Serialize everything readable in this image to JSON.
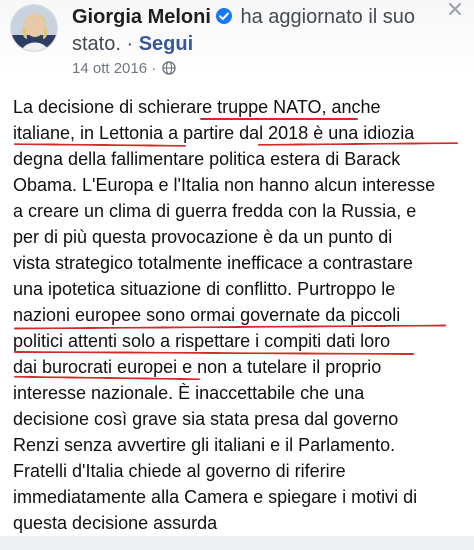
{
  "post": {
    "author": "Giorgia Meloni",
    "verified_icon": "verified-badge-icon",
    "action": "ha aggiornato il suo",
    "action_cont": "stato.",
    "separator": "·",
    "follow_label": "Segui",
    "date": "14 ott 2016",
    "date_separator": "·",
    "privacy_icon": "globe-icon",
    "close_icon": "close-icon",
    "body_lines": [
      "La decisione di schierare truppe NATO, anche",
      "italiane, in Lettonia a partire dal 2018 è una idiozia",
      "degna della fallimentare politica estera di Barack",
      "Obama. L'Europa e l'Italia non hanno alcun interesse",
      "a creare un clima di guerra fredda con la Russia, e",
      "per di più questa provocazione è da un punto di",
      "vista strategico totalmente inefficace a contrastare",
      "una ipotetica situazione di conflitto. Purtroppo le",
      "nazioni europee sono ormai governate da piccoli",
      "politici attenti solo a rispettare i compiti dati loro",
      "dai burocrati europei e non a tutelare il proprio",
      "interesse nazionale. È inaccettabile che una",
      "decisione così grave sia stata presa dal governo",
      "Renzi senza avvertire gli italiani e il Parlamento.",
      "Fratelli d'Italia chiede al governo di riferire",
      "immediatamente alla Camera e spiegare i motivi di",
      "questa decisione assurda"
    ]
  },
  "colors": {
    "annotation_red": "#d42a2a",
    "link_blue": "#385898",
    "verified_blue": "#1877f2"
  }
}
